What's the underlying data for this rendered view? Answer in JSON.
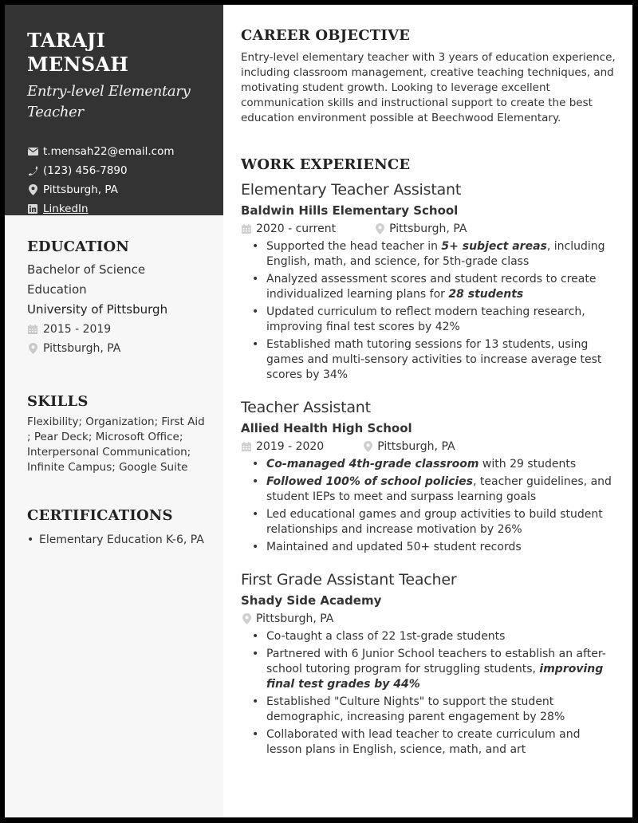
{
  "header": {
    "name": "TARAJI MENSAH",
    "title": "Entry-level Elementary Teacher"
  },
  "contact": {
    "email": "t.mensah22@email.com",
    "phone": "(123) 456-7890",
    "location": "Pittsburgh, PA",
    "linkedin": "LinkedIn"
  },
  "education": {
    "heading": "EDUCATION",
    "degree": "Bachelor of Science Education",
    "school": "University of Pittsburgh",
    "dates": "2015 - 2019",
    "location": "Pittsburgh, PA"
  },
  "skills": {
    "heading": "SKILLS",
    "text": "Flexibility; Organization; First Aid ; Pear Deck; Microsoft Office; Interpersonal Communication; Infinite Campus; Google Suite"
  },
  "certifications": {
    "heading": "CERTIFICATIONS",
    "items": [
      "Elementary Education K-6, PA"
    ]
  },
  "objective": {
    "heading": "CAREER OBJECTIVE",
    "text": "Entry-level elementary teacher with 3 years of education experience, including classroom management, creative teaching techniques, and motivating student growth. Looking to leverage excellent communication skills and instructional support to create the best education environment possible at Beechwood Elementary."
  },
  "work": {
    "heading": "WORK EXPERIENCE",
    "jobs": [
      {
        "title": "Elementary Teacher Assistant",
        "company": "Baldwin Hills Elementary School",
        "dates": "2020 - current",
        "location": "Pittsburgh, PA",
        "bullets": [
          {
            "pre": "Supported the head teacher in ",
            "em": "5+ subject areas",
            "post": ", including English, math, and science, for 5th-grade class"
          },
          {
            "pre": "Analyzed assessment scores and student records to create individualized learning plans for ",
            "em": "28 students",
            "post": ""
          },
          {
            "pre": "Updated curriculum to reflect modern teaching research, improving final test scores by 42%",
            "em": "",
            "post": ""
          },
          {
            "pre": "Established math tutoring sessions for 13 students, using games and multi-sensory activities to increase average test scores by 34%",
            "em": "",
            "post": ""
          }
        ]
      },
      {
        "title": "Teacher Assistant",
        "company": "Allied Health High School",
        "dates": "2019 - 2020",
        "location": "Pittsburgh, PA",
        "bullets": [
          {
            "pre": "",
            "em": "Co-managed 4th-grade classroom",
            "post": " with 29 students"
          },
          {
            "pre": "",
            "em": "Followed 100% of school policies",
            "post": ", teacher guidelines, and student IEPs to meet and surpass learning goals"
          },
          {
            "pre": "Led educational games and group activities to build student relationships and increase motivation by 26%",
            "em": "",
            "post": ""
          },
          {
            "pre": "Maintained and updated 50+ student records",
            "em": "",
            "post": ""
          }
        ]
      },
      {
        "title": "First Grade Assistant Teacher",
        "company": "Shady Side Academy",
        "dates": "",
        "location": "Pittsburgh, PA",
        "bullets": [
          {
            "pre": "Co-taught a class of 22 1st-grade students",
            "em": "",
            "post": ""
          },
          {
            "pre": "Partnered with 6 Junior School teachers to establish an after-school tutoring program for struggling students, ",
            "em": "improving final test grades by 44%",
            "post": ""
          },
          {
            "pre": "Established \"Culture Nights\" to support the student demographic, increasing parent engagement by 28%",
            "em": "",
            "post": ""
          },
          {
            "pre": "Collaborated with lead teacher to create curriculum and lesson plans in English, science, math, and art",
            "em": "",
            "post": ""
          }
        ]
      }
    ]
  },
  "icons": {
    "email": "envelope-icon",
    "phone": "phone-icon",
    "location": "map-pin-icon",
    "linkedin": "linkedin-icon",
    "calendar": "calendar-icon"
  },
  "colors": {
    "sidebar_dark": "#333333",
    "sidebar_light": "#f7f7f7",
    "text": "#333333",
    "icon_gray": "#c4c4c4"
  }
}
